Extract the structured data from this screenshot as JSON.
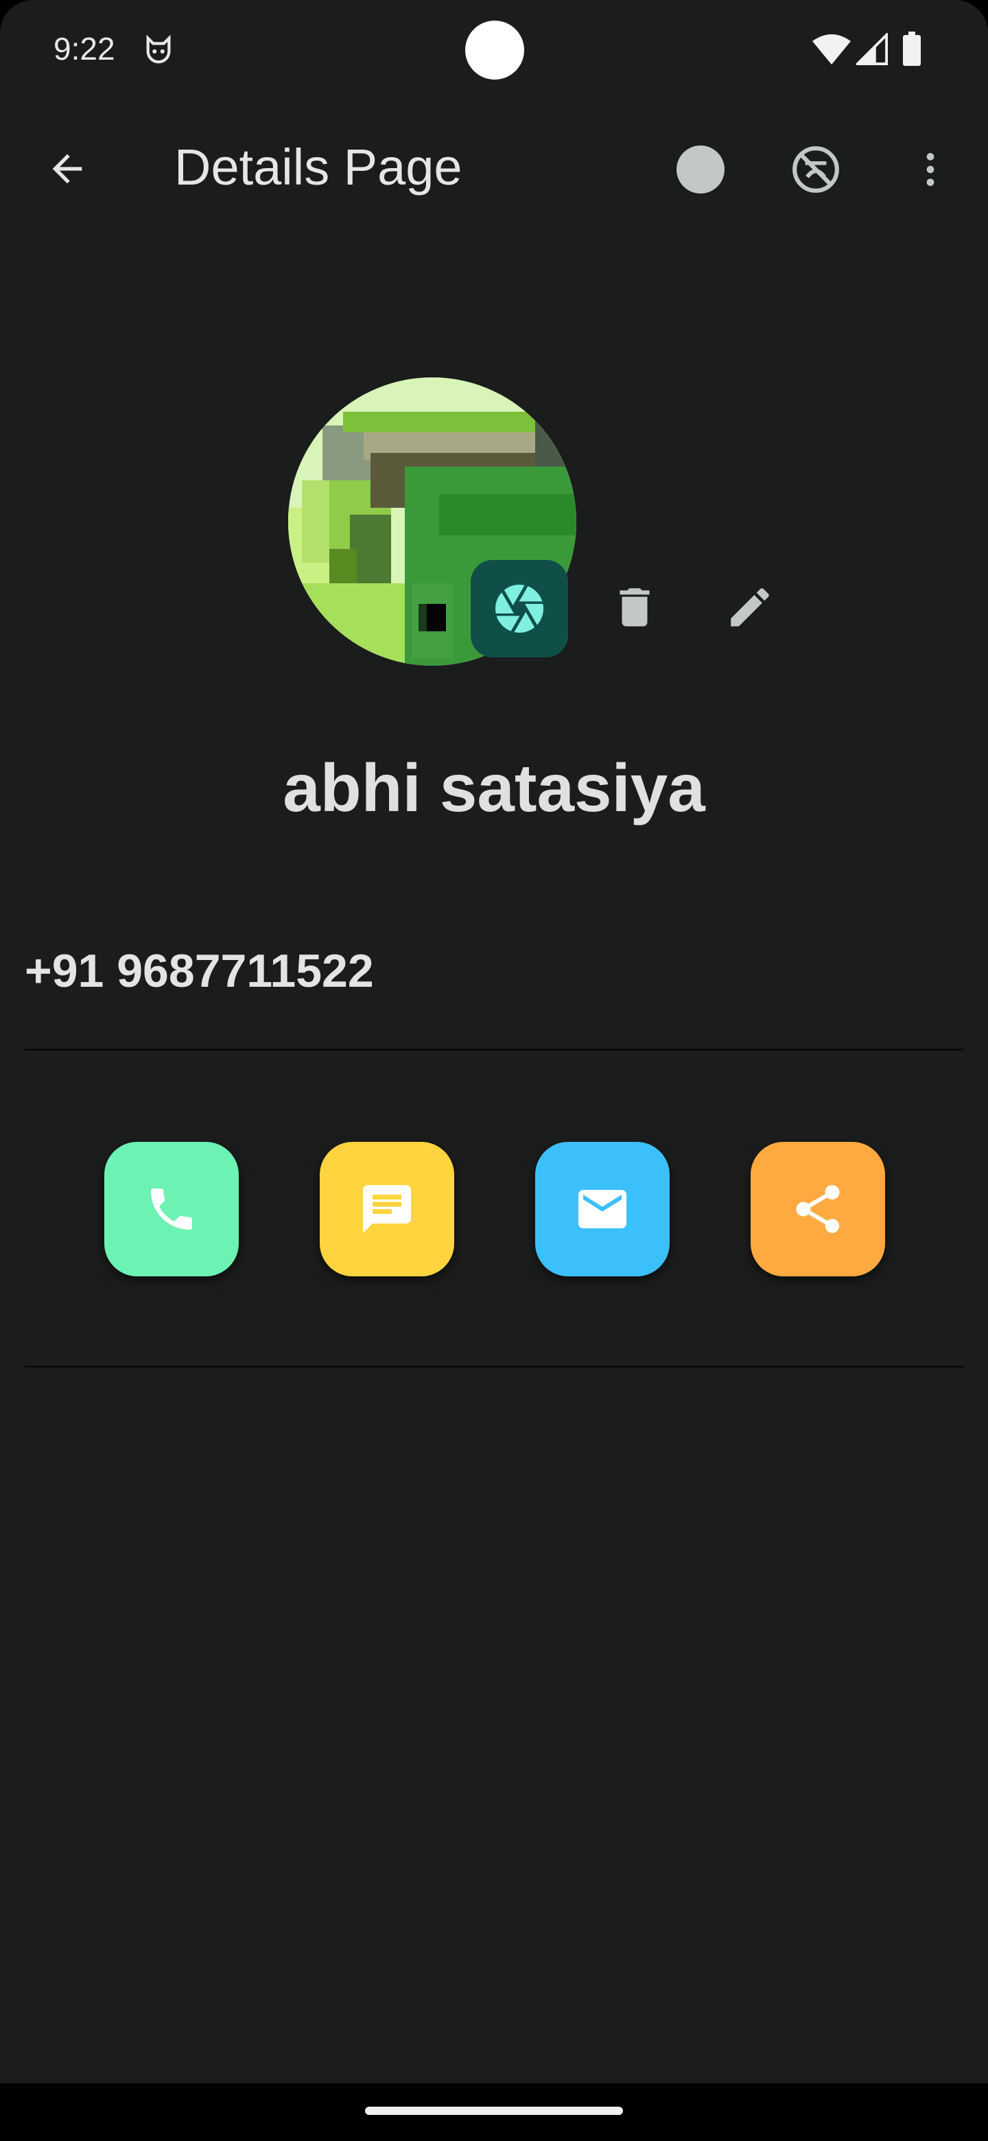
{
  "status_bar": {
    "time": "9:22",
    "notification_icon": "cat-face-icon",
    "wifi_icon": "wifi-icon",
    "signal_icon": "cellular-signal-icon",
    "battery_icon": "battery-full-icon"
  },
  "app_bar": {
    "title": "Details Page",
    "back_icon": "arrow-back-icon",
    "dot_icon": "circle-dot-icon",
    "incognito_icon": "incognito-off-icon",
    "more_icon": "more-vert-icon"
  },
  "contact": {
    "name": "abhi satasiya",
    "phone": "+91 9687711522",
    "avatar_icon": "contact-photo",
    "camera_icon": "camera-aperture-icon",
    "delete_icon": "delete-icon",
    "edit_icon": "edit-pencil-icon"
  },
  "actions": [
    {
      "icon": "phone-icon",
      "color": "#6cf2b3"
    },
    {
      "icon": "message-icon",
      "color": "#ffd43f"
    },
    {
      "icon": "email-icon",
      "color": "#3cc0fc"
    },
    {
      "icon": "share-icon",
      "color": "#ffaa41"
    }
  ],
  "colors": {
    "background": "#1b1c1c",
    "camera_fab": "#0f4f47",
    "camera_icon": "#7ff0e0",
    "icon_tint": "#c3c7c7"
  }
}
